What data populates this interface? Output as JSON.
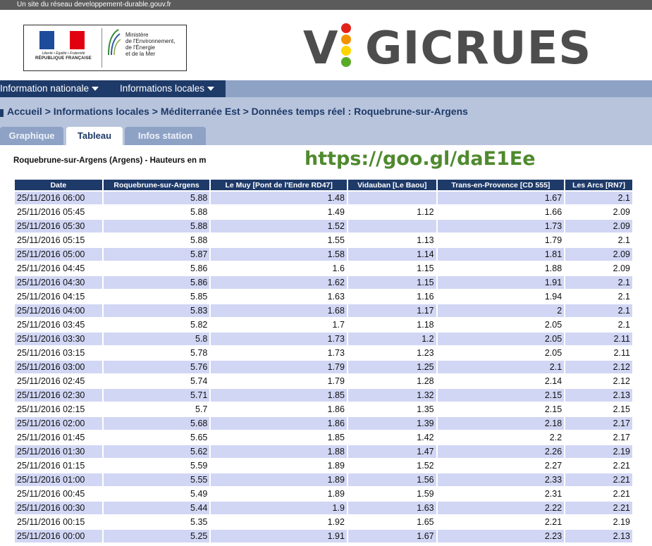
{
  "topbar": {
    "text": "Un site du réseau developpement-durable.gouv.fr"
  },
  "header": {
    "republic": {
      "motto": "Liberté • Égalité • Fraternité",
      "name": "RÉPUBLIQUE FRANÇAISE"
    },
    "ministry": [
      "Ministère",
      "de l'Environnement,",
      "de l'Énergie",
      "et de la Mer"
    ],
    "brand": {
      "v": "V",
      "rest": "GICRUES"
    },
    "colors": {
      "flag_blue": "#1e4b9b",
      "flag_red": "#e1000f",
      "brand_text": "#4d4d4d",
      "light_red": "#e2231a",
      "light_orange": "#f39200",
      "light_yellow": "#ffd400",
      "light_green": "#5aaa28"
    }
  },
  "nav": {
    "items": [
      "Information nationale",
      "Informations locales"
    ]
  },
  "breadcrumb": {
    "text": "Accueil > Informations locales > Méditerranée Est > Données temps réel : Roquebrune-sur-Argens"
  },
  "tabs": [
    {
      "label": "Graphique",
      "active": false
    },
    {
      "label": "Tableau",
      "active": true
    },
    {
      "label": "Infos station",
      "active": false
    }
  ],
  "content": {
    "caption": "Roquebrune-sur-Argens (Argens) - Hauteurs en m",
    "overlay_url": "https://goo.gl/daE1Ee"
  },
  "table": {
    "columns": [
      "Date",
      "Roquebrune-sur-Argens",
      "Le Muy [Pont de l'Endre RD47]",
      "Vidauban [Le Baou]",
      "Trans-en-Provence [CD 555]",
      "Les Arcs [RN7]"
    ],
    "rows": [
      [
        "25/11/2016 06:00",
        "5.88",
        "1.48",
        "",
        "1.67",
        "2.1"
      ],
      [
        "25/11/2016 05:45",
        "5.88",
        "1.49",
        "1.12",
        "1.66",
        "2.09"
      ],
      [
        "25/11/2016 05:30",
        "5.88",
        "1.52",
        "",
        "1.73",
        "2.09"
      ],
      [
        "25/11/2016 05:15",
        "5.88",
        "1.55",
        "1.13",
        "1.79",
        "2.1"
      ],
      [
        "25/11/2016 05:00",
        "5.87",
        "1.58",
        "1.14",
        "1.81",
        "2.09"
      ],
      [
        "25/11/2016 04:45",
        "5.86",
        "1.6",
        "1.15",
        "1.88",
        "2.09"
      ],
      [
        "25/11/2016 04:30",
        "5.86",
        "1.62",
        "1.15",
        "1.91",
        "2.1"
      ],
      [
        "25/11/2016 04:15",
        "5.85",
        "1.63",
        "1.16",
        "1.94",
        "2.1"
      ],
      [
        "25/11/2016 04:00",
        "5.83",
        "1.68",
        "1.17",
        "2",
        "2.1"
      ],
      [
        "25/11/2016 03:45",
        "5.82",
        "1.7",
        "1.18",
        "2.05",
        "2.1"
      ],
      [
        "25/11/2016 03:30",
        "5.8",
        "1.73",
        "1.2",
        "2.05",
        "2.11"
      ],
      [
        "25/11/2016 03:15",
        "5.78",
        "1.73",
        "1.23",
        "2.05",
        "2.11"
      ],
      [
        "25/11/2016 03:00",
        "5.76",
        "1.79",
        "1.25",
        "2.1",
        "2.12"
      ],
      [
        "25/11/2016 02:45",
        "5.74",
        "1.79",
        "1.28",
        "2.14",
        "2.12"
      ],
      [
        "25/11/2016 02:30",
        "5.71",
        "1.85",
        "1.32",
        "2.15",
        "2.13"
      ],
      [
        "25/11/2016 02:15",
        "5.7",
        "1.86",
        "1.35",
        "2.15",
        "2.15"
      ],
      [
        "25/11/2016 02:00",
        "5.68",
        "1.86",
        "1.39",
        "2.18",
        "2.17"
      ],
      [
        "25/11/2016 01:45",
        "5.65",
        "1.85",
        "1.42",
        "2.2",
        "2.17"
      ],
      [
        "25/11/2016 01:30",
        "5.62",
        "1.88",
        "1.47",
        "2.26",
        "2.19"
      ],
      [
        "25/11/2016 01:15",
        "5.59",
        "1.89",
        "1.52",
        "2.27",
        "2.21"
      ],
      [
        "25/11/2016 01:00",
        "5.55",
        "1.89",
        "1.56",
        "2.33",
        "2.21"
      ],
      [
        "25/11/2016 00:45",
        "5.49",
        "1.89",
        "1.59",
        "2.31",
        "2.21"
      ],
      [
        "25/11/2016 00:30",
        "5.44",
        "1.9",
        "1.63",
        "2.22",
        "2.21"
      ],
      [
        "25/11/2016 00:15",
        "5.35",
        "1.92",
        "1.65",
        "2.21",
        "2.19"
      ],
      [
        "25/11/2016 00:00",
        "5.25",
        "1.91",
        "1.67",
        "2.23",
        "2.13"
      ]
    ]
  }
}
